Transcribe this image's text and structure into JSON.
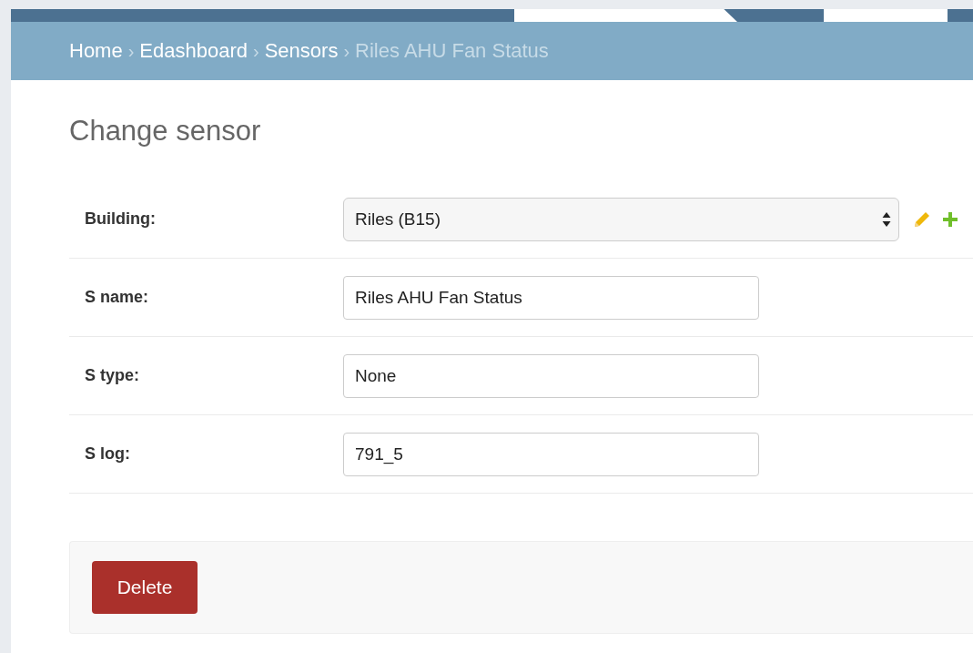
{
  "breadcrumbs": [
    {
      "label": "Home",
      "current": false
    },
    {
      "label": "Edashboard",
      "current": false
    },
    {
      "label": "Sensors",
      "current": false
    },
    {
      "label": "Riles AHU Fan Status",
      "current": true
    }
  ],
  "separator": "›",
  "heading": "Change sensor",
  "fields": [
    {
      "kind": "select",
      "label": "Building:",
      "value": "Riles (B15)"
    },
    {
      "kind": "text",
      "label": "S name:",
      "value": "Riles AHU Fan Status"
    },
    {
      "kind": "text",
      "label": "S type:",
      "value": "None"
    },
    {
      "kind": "text",
      "label": "S log:",
      "value": "791_5"
    }
  ],
  "delete_button": "Delete"
}
